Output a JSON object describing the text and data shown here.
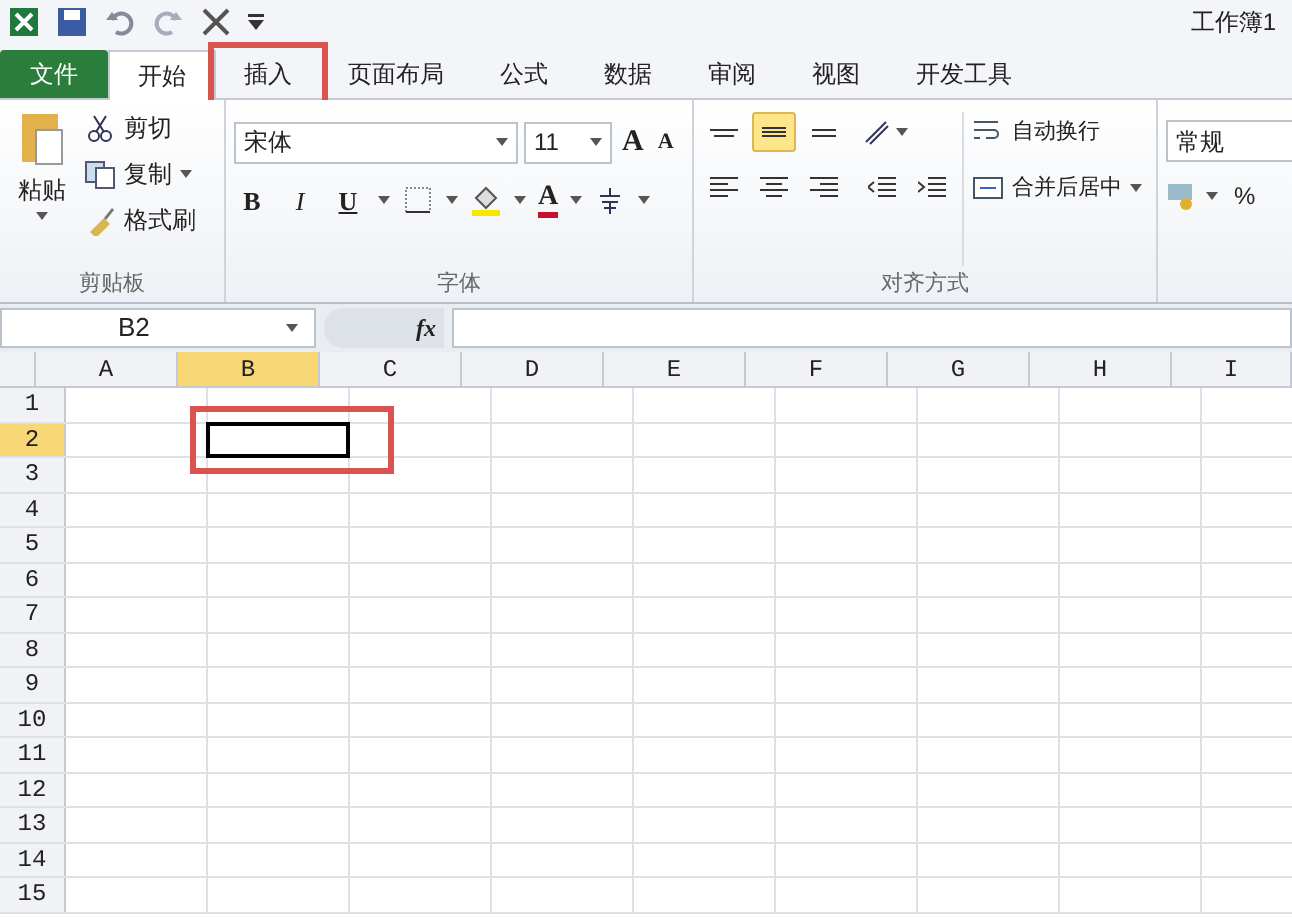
{
  "window": {
    "title": "工作簿1"
  },
  "file_tab": {
    "label": "文件"
  },
  "tabs": [
    {
      "label": "开始",
      "selected": true,
      "marked": false
    },
    {
      "label": "插入",
      "selected": false,
      "marked": true
    },
    {
      "label": "页面布局",
      "selected": false,
      "marked": false
    },
    {
      "label": "公式",
      "selected": false,
      "marked": false
    },
    {
      "label": "数据",
      "selected": false,
      "marked": false
    },
    {
      "label": "审阅",
      "selected": false,
      "marked": false
    },
    {
      "label": "视图",
      "selected": false,
      "marked": false
    },
    {
      "label": "开发工具",
      "selected": false,
      "marked": false
    }
  ],
  "clipboard": {
    "paste": "粘贴",
    "cut": "剪切",
    "copy": "复制",
    "format_painter": "格式刷",
    "label": "剪贴板"
  },
  "font": {
    "name": "宋体",
    "size": "11",
    "grow": "A",
    "shrink": "A",
    "bold": "B",
    "italic": "I",
    "underline": "U",
    "font_color": "A",
    "label": "字体"
  },
  "alignment": {
    "middle_selected": true,
    "wrap": "自动换行",
    "merge": "合并后居中",
    "label": "对齐方式"
  },
  "number": {
    "format": "常规",
    "percent": "%"
  },
  "formula_bar": {
    "name_box": "B2",
    "fx": "fx"
  },
  "sheet": {
    "columns": [
      {
        "label": "A",
        "selected": false
      },
      {
        "label": "B",
        "selected": true
      },
      {
        "label": "C",
        "selected": false
      },
      {
        "label": "D",
        "selected": false
      },
      {
        "label": "E",
        "selected": false
      },
      {
        "label": "F",
        "selected": false
      },
      {
        "label": "G",
        "selected": false
      },
      {
        "label": "H",
        "selected": false
      },
      {
        "label": "I",
        "selected": false
      }
    ],
    "rows": [
      {
        "label": "1",
        "selected": false
      },
      {
        "label": "2",
        "selected": true
      },
      {
        "label": "3",
        "selected": false
      },
      {
        "label": "4",
        "selected": false
      },
      {
        "label": "5",
        "selected": false
      },
      {
        "label": "6",
        "selected": false
      },
      {
        "label": "7",
        "selected": false
      },
      {
        "label": "8",
        "selected": false
      },
      {
        "label": "9",
        "selected": false
      },
      {
        "label": "10",
        "selected": false
      },
      {
        "label": "11",
        "selected": false
      },
      {
        "label": "12",
        "selected": false
      },
      {
        "label": "13",
        "selected": false
      },
      {
        "label": "14",
        "selected": false
      },
      {
        "label": "15",
        "selected": false
      }
    ],
    "active_cell_marked": true
  }
}
